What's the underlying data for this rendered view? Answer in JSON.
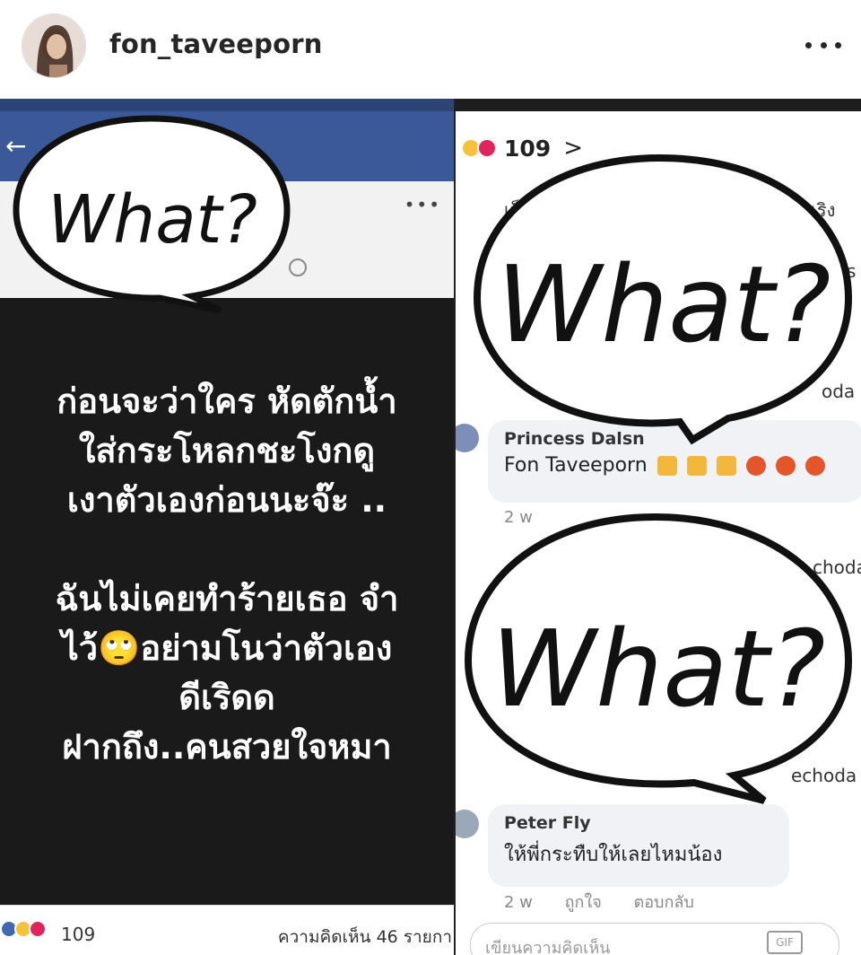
{
  "header": {
    "username": "fon_taveeporn",
    "more_icon": "more-horizontal-icon"
  },
  "left": {
    "back_icon": "back-arrow-icon",
    "more_dots": "•••",
    "lines": [
      "ก่อนจะว่าใคร หัดตักน้ำ",
      "ใส่กระโหลกชะโงกดู",
      "เงาตัวเองก่อนนะจ๊ะ ..",
      "",
      "ฉันไม่เคยทำร้ายเธอ จำ",
      "ไว้🙄อย่ามโนว่าตัวเอง",
      "ดีเริดด",
      "ฝากถึง..คนสวยใจหมา"
    ],
    "reaction_count": "109",
    "comment_count": "ความคิดเห็น 46 รายกา"
  },
  "right": {
    "reaction_count": "109",
    "chevron": ">",
    "partials": {
      "top_left": "เป็",
      "top_right": "เริง",
      "mid_right_1": "oda",
      "mid_right_2": "choda",
      "mid_right_3": "echoda",
      "right_s": "s"
    },
    "comments": [
      {
        "name": "Princess Dalsn",
        "text": "Fon Taveeporn",
        "time": "2 w"
      },
      {
        "name": "Peter Fly",
        "text": "ให้พี่กระทืบให้เลยไหมน้อง",
        "time": "2 w",
        "like": "ถูกใจ",
        "reply": "ตอบกลับ"
      }
    ],
    "write_placeholder": "เขียนความคิดเห็น",
    "gif_label": "GIF"
  },
  "overlay": {
    "bubble_text": "What?"
  },
  "colors": {
    "fb_blue": "#3b5998",
    "black_box": "#1a1a1a",
    "username": "#262626"
  }
}
